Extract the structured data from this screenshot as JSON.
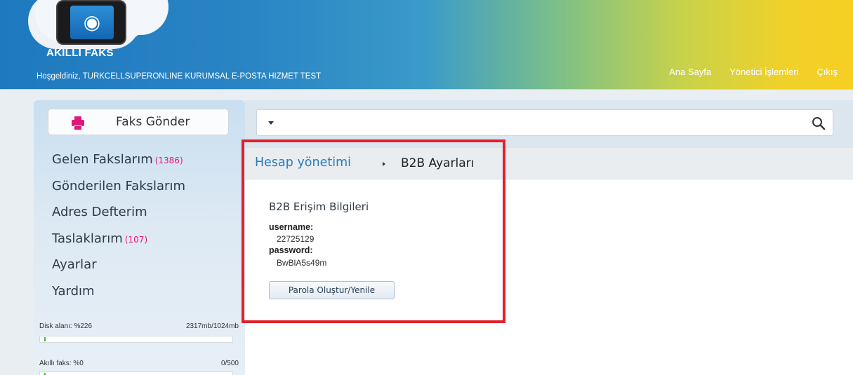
{
  "header": {
    "app_name": "AKILLI FAKS",
    "welcome": "Hoşgeldiniz, TURKCELLSUPERONLINE KURUMSAL E-POSTA HIZMET TEST",
    "nav": [
      "Ana Sayfa",
      "Yönetici İşlemleri",
      "Çıkış"
    ]
  },
  "sidebar": {
    "send_fax_label": "Faks Gönder",
    "menu": [
      {
        "label": "Gelen Fakslarım",
        "count": "(1386)"
      },
      {
        "label": "Gönderilen Fakslarım",
        "count": ""
      },
      {
        "label": "Adres Defterim",
        "count": ""
      },
      {
        "label": "Taslaklarım",
        "count": "(107)"
      },
      {
        "label": "Ayarlar",
        "count": ""
      },
      {
        "label": "Yardım",
        "count": ""
      }
    ],
    "disk": {
      "label": "Disk alanı: %226",
      "value": "2317mb/1024mb"
    },
    "smart_fax": {
      "label": "Akıllı faks: %0",
      "value": "0/500"
    }
  },
  "breadcrumb": {
    "parent": "Hesap yönetimi",
    "current": "B2B Ayarları"
  },
  "b2b": {
    "title": "B2B Erişim Bilgileri",
    "username_label": "username:",
    "username": "22725129",
    "password_label": "password:",
    "password": "BwBlA5s49m",
    "button": "Parola Oluştur/Yenile"
  },
  "colors": {
    "accent_pink": "#e2177b",
    "link_blue": "#2a7db6",
    "highlight_red": "#e2202b"
  }
}
